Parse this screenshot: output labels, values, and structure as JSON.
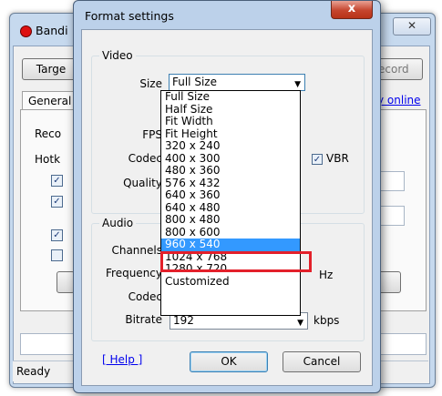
{
  "background": {
    "title": "Bandi",
    "buttons": {
      "target": "Targe",
      "record": "ecord"
    },
    "tab_general": "General",
    "link_online": "y online",
    "fragments": {
      "reco": "Reco",
      "hotk": "Hotk"
    },
    "status": "Ready"
  },
  "dialog": {
    "title": "Format settings",
    "close_glyph": "x",
    "video_group": "Video",
    "audio_group": "Audio",
    "labels": {
      "size": "Size",
      "fps": "FPS",
      "codec": "Codec",
      "quality": "Quality",
      "channels": "Channels",
      "frequency": "Frequency",
      "audio_codec": "Codec",
      "bitrate": "Bitrate"
    },
    "size_value": "Full Size",
    "vbr_label": "VBR",
    "vbr_checked": true,
    "frequency_unit": "Hz",
    "bitrate_value": "192",
    "bitrate_unit": "kbps",
    "help_link": "[ Help ]",
    "ok_label": "OK",
    "cancel_label": "Cancel"
  },
  "size_options": [
    "Full Size",
    "Half Size",
    "Fit Width",
    "Fit Height",
    "320 x 240",
    "400 x 300",
    "480 x 360",
    "576 x 432",
    "640 x 360",
    "640 x 480",
    "800 x 480",
    "800 x 600",
    "960 x 540",
    "1024 x 768",
    "1280 x 720",
    "Customized"
  ],
  "selected_option": "960 x 540",
  "colors": {
    "selection": "#3399ff",
    "highlight_box": "#e3202a",
    "link": "#0000ee"
  }
}
